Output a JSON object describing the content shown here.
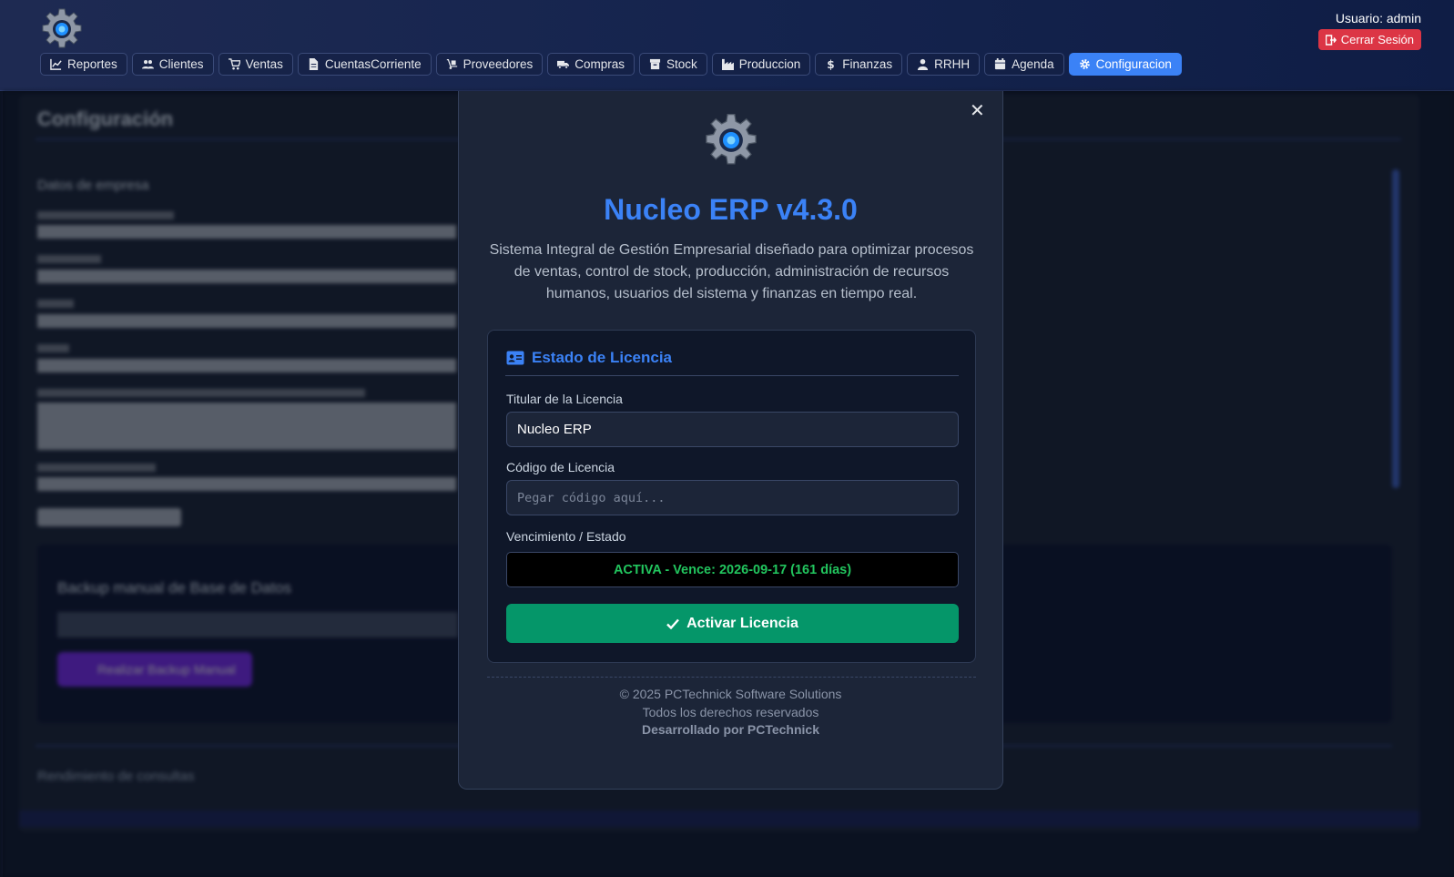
{
  "header": {
    "user_label": "Usuario: admin",
    "logout_label": "Cerrar Sesión",
    "nav": [
      {
        "label": "Reportes",
        "icon": "chart-line-icon"
      },
      {
        "label": "Clientes",
        "icon": "users-icon"
      },
      {
        "label": "Ventas",
        "icon": "cart-icon"
      },
      {
        "label": "CuentasCorriente",
        "icon": "file-icon"
      },
      {
        "label": "Proveedores",
        "icon": "dolly-icon"
      },
      {
        "label": "Compras",
        "icon": "truck-icon"
      },
      {
        "label": "Stock",
        "icon": "box-icon"
      },
      {
        "label": "Produccion",
        "icon": "industry-icon"
      },
      {
        "label": "Finanzas",
        "icon": "dollar-icon"
      },
      {
        "label": "RRHH",
        "icon": "user-icon"
      },
      {
        "label": "Agenda",
        "icon": "calendar-icon"
      },
      {
        "label": "Configuracion",
        "icon": "gear-icon",
        "active": true
      }
    ]
  },
  "background": {
    "title": "Configuración",
    "section": "Datos de empresa",
    "backup_title": "Backup manual de Base de Datos",
    "backup_button": "Realizar Backup Manual",
    "footer_text": "Rendimiento de consultas"
  },
  "modal": {
    "title": "Nucleo ERP v4.3.0",
    "description": "Sistema Integral de Gestión Empresarial diseñado para optimizar procesos de ventas, control de stock, producción, administración de recursos humanos, usuarios del sistema y finanzas en tiempo real.",
    "license": {
      "heading": "Estado de Licencia",
      "holder_label": "Titular de la Licencia",
      "holder_value": "Nucleo ERP",
      "code_label": "Código de Licencia",
      "code_placeholder": "Pegar código aquí...",
      "status_label": "Vencimiento / Estado",
      "status_value": "ACTIVA - Vence: 2026-09-17 (161 días)",
      "activate_button": "Activar Licencia"
    },
    "footer": {
      "copyright": "© 2025 PCTechnick Software Solutions",
      "rights": "Todos los derechos reservados",
      "developer": "Desarrollado por PCTechnick"
    }
  },
  "colors": {
    "accent": "#3b82f6",
    "success": "#059669",
    "status_text": "#22c55e",
    "danger": "#dc3545"
  }
}
